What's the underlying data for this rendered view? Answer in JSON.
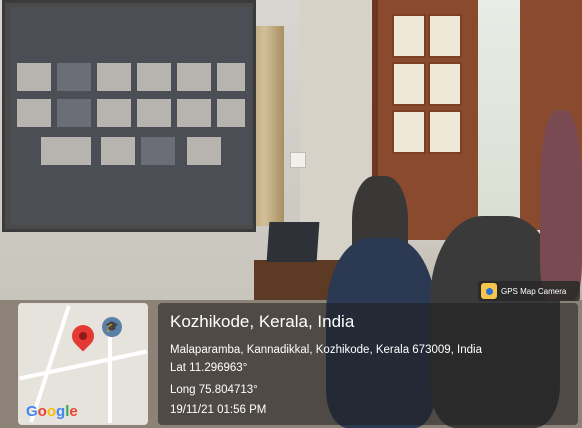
{
  "overlay": {
    "app_badge": "GPS Map Camera",
    "location_title": "Kozhikode, Kerala, India",
    "address": "Malaparamba, Kannadikkal, Kozhikode, Kerala 673009, India",
    "latitude": "Lat 11.296963°",
    "longitude": "Long 75.804713°",
    "timestamp": "19/11/21 01:56 PM",
    "map_brand": "Google",
    "pin_color": "#e53935"
  }
}
